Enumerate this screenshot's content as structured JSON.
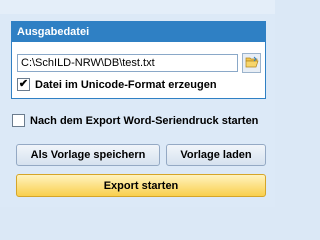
{
  "group": {
    "title": "Ausgabedatei",
    "path_value": "C:\\SchILD-NRW\\DB\\test.txt",
    "browse_icon": "folder-open-icon",
    "unicode_label": "Datei im Unicode-Format erzeugen",
    "unicode_checked": true,
    "unicode_mark": "✔"
  },
  "word_serial": {
    "label": "Nach dem Export Word-Seriendruck starten",
    "checked": false
  },
  "buttons": {
    "save_template": "Als Vorlage speichern",
    "load_template": "Vorlage laden",
    "start_export": "Export starten"
  },
  "colors": {
    "accent": "#2f80c4",
    "background": "#dce9f7",
    "export_button": "#f9cf4d"
  }
}
